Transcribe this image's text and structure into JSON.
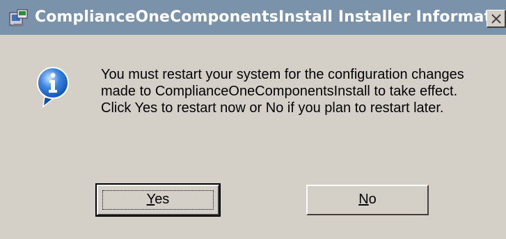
{
  "window": {
    "title": "ComplianceOneComponentsInstall Installer Information",
    "icons": {
      "title": "installer-app-icon",
      "close": "close-icon",
      "info": "information-icon"
    }
  },
  "dialog": {
    "message": "You must restart your system for the configuration changes made to ComplianceOneComponentsInstall to take effect. Click Yes to restart now or No if you plan to restart later.",
    "buttons": {
      "yes_label": "Yes",
      "no_label": "No"
    }
  },
  "colors": {
    "titlebar": "#7b93aa",
    "face": "#d4d0c8",
    "info_blue": "#1f6fd6"
  }
}
